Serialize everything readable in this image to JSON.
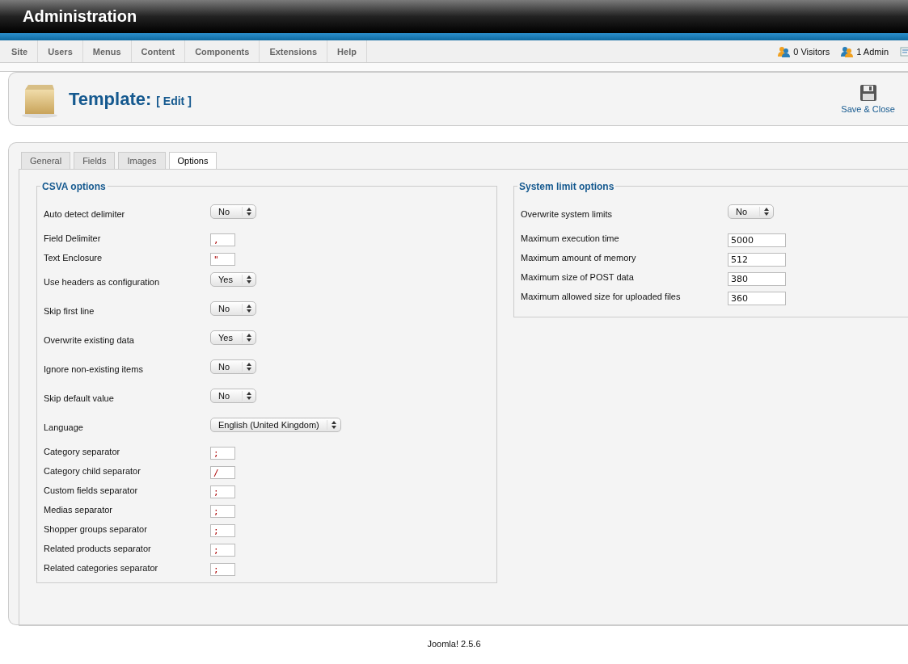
{
  "header": {
    "title": "Administration"
  },
  "menu": {
    "items": [
      "Site",
      "Users",
      "Menus",
      "Content",
      "Components",
      "Extensions",
      "Help"
    ],
    "status": [
      {
        "kind": "visitors",
        "label": "0 Visitors"
      },
      {
        "kind": "admin",
        "label": "1 Admin"
      },
      {
        "kind": "messages"
      }
    ]
  },
  "toolbar": {
    "title": "Template:",
    "subtitle": "[ Edit ]",
    "buttons": [
      {
        "kind": "save",
        "label": "Save & Close"
      }
    ]
  },
  "tabs": [
    {
      "label": "General",
      "selected": false
    },
    {
      "label": "Fields",
      "selected": false
    },
    {
      "label": "Images",
      "selected": false
    },
    {
      "label": "Options",
      "selected": true
    }
  ],
  "fieldsets": [
    {
      "legend": "CSVA options",
      "fields": [
        {
          "kind": "select",
          "label": "Auto detect delimiter",
          "value": "No"
        },
        {
          "kind": "text",
          "label": "Field Delimiter",
          "value": ","
        },
        {
          "kind": "text",
          "label": "Text Enclosure",
          "value": "\""
        },
        {
          "kind": "select",
          "label": "Use headers as configuration",
          "value": "Yes"
        },
        {
          "kind": "select",
          "label": "Skip first line",
          "value": "No"
        },
        {
          "kind": "select",
          "label": "Overwrite existing data",
          "value": "Yes"
        },
        {
          "kind": "select",
          "label": "Ignore non-existing items",
          "value": "No"
        },
        {
          "kind": "select",
          "label": "Skip default value",
          "value": "No"
        },
        {
          "kind": "wideselect",
          "label": "Language",
          "value": "English (United Kingdom)"
        },
        {
          "kind": "text",
          "label": "Category separator",
          "value": ";"
        },
        {
          "kind": "text",
          "label": "Category child separator",
          "value": "/"
        },
        {
          "kind": "text",
          "label": "Custom fields separator",
          "value": ";"
        },
        {
          "kind": "text",
          "label": "Medias separator",
          "value": ";"
        },
        {
          "kind": "text",
          "label": "Shopper groups separator",
          "value": ";"
        },
        {
          "kind": "text",
          "label": "Related products separator",
          "value": ";"
        },
        {
          "kind": "text",
          "label": "Related categories separator",
          "value": ";"
        }
      ]
    },
    {
      "legend": "System limit options",
      "fields": [
        {
          "kind": "select",
          "label": "Overwrite system limits",
          "value": "No"
        },
        {
          "kind": "number",
          "label": "Maximum execution time",
          "value": "5000"
        },
        {
          "kind": "number",
          "label": "Maximum amount of memory",
          "value": "512"
        },
        {
          "kind": "number",
          "label": "Maximum size of POST data",
          "value": "380"
        },
        {
          "kind": "number",
          "label": "Maximum allowed size for uploaded files",
          "value": "360"
        }
      ]
    }
  ],
  "footer": "Joomla! 2.5.6"
}
